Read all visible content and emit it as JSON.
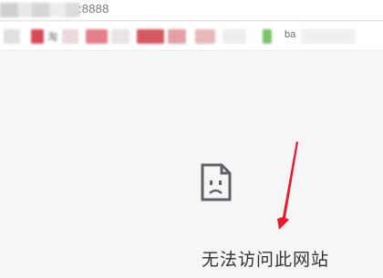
{
  "address_bar": {
    "url_suffix": ":8888"
  },
  "bookmarks": {
    "items": [
      {
        "label": "淘",
        "color": "#d84b55"
      },
      {
        "label": "",
        "color": "#e57f8a"
      },
      {
        "label": "",
        "color": "#e2a0a6"
      },
      {
        "label": "",
        "color": "#d25a62"
      },
      {
        "label": "",
        "color": "#e8b7bb"
      },
      {
        "label": "ba",
        "color": "#7ac36a"
      }
    ]
  },
  "error_page": {
    "icon": "sad-page-icon",
    "title": "无法访问此网站"
  },
  "colors": {
    "arrow": "#e8192c",
    "page_background": "#f6f6f6",
    "title_text": "#333333"
  }
}
